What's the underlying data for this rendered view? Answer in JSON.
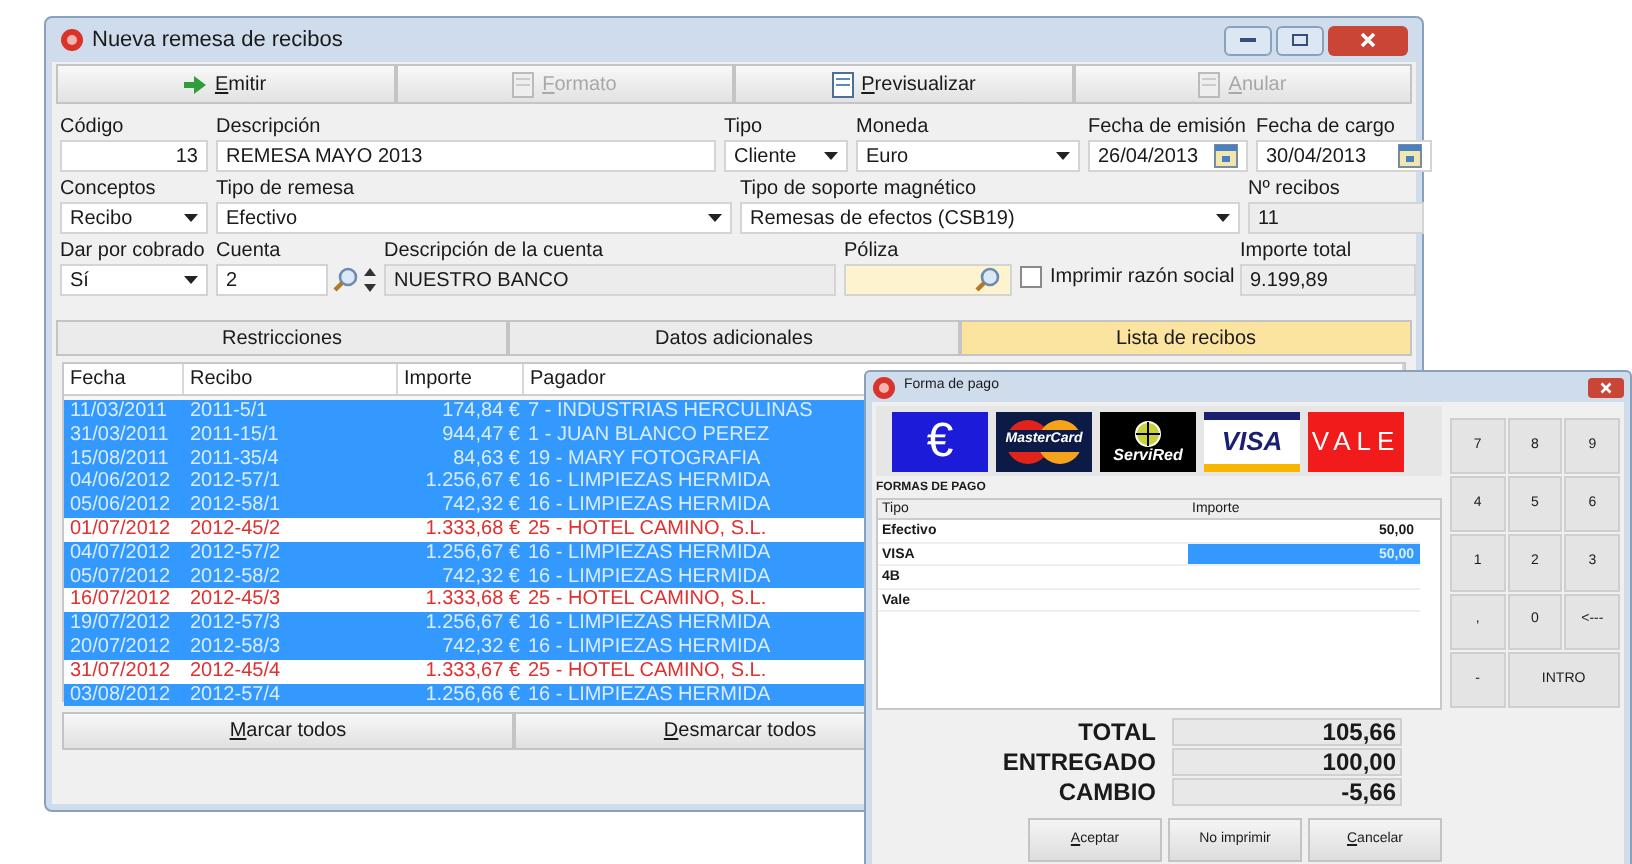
{
  "window": {
    "title": "Nueva remesa de recibos"
  },
  "toolbar": [
    {
      "label": "Emitir",
      "disabled": false,
      "kind": "arrow"
    },
    {
      "label": "Formato",
      "disabled": true,
      "kind": "doc"
    },
    {
      "label": "Previsualizar",
      "disabled": false,
      "kind": "doc"
    },
    {
      "label": "Anular",
      "disabled": true,
      "kind": "doc"
    }
  ],
  "form_rows": [
    [
      {
        "label": "Código",
        "value": "13",
        "kind": "number"
      },
      {
        "label": "Descripción",
        "value": "REMESA MAYO 2013",
        "kind": "text"
      },
      {
        "label": "Tipo",
        "value": "Cliente",
        "kind": "select"
      },
      {
        "label": "Moneda",
        "value": "Euro",
        "kind": "select"
      },
      {
        "label": "Fecha de emisión",
        "value": "26/04/2013",
        "kind": "date"
      },
      {
        "label": "Fecha de cargo",
        "value": "30/04/2013",
        "kind": "date"
      }
    ],
    [
      {
        "label": "Conceptos",
        "value": "Recibo",
        "kind": "select"
      },
      {
        "label": "Tipo de remesa",
        "value": "Efectivo",
        "kind": "select"
      },
      {
        "label": "Tipo de soporte magnético",
        "value": "Remesas de efectos (CSB19)",
        "kind": "select"
      },
      {
        "label": "Nº recibos",
        "value": "11",
        "kind": "readonly"
      }
    ],
    [
      {
        "label": "Dar por cobrado",
        "value": "Sí",
        "kind": "select"
      },
      {
        "label": "Cuenta",
        "value": "2",
        "kind": "spinlookup"
      },
      {
        "label": "Descripción de la cuenta",
        "value": "NUESTRO BANCO",
        "kind": "readonly"
      },
      {
        "label": "Póliza",
        "kind": "lookup"
      },
      {
        "label": "Imprimir razón social",
        "kind": "checkbox",
        "checked": false
      },
      {
        "label": "Importe total",
        "value": "9.199,89",
        "kind": "readonly"
      }
    ]
  ],
  "tabs": [
    {
      "label": "Restricciones",
      "selected": false
    },
    {
      "label": "Datos adicionales",
      "selected": false
    },
    {
      "label": "Lista de recibos",
      "selected": true
    }
  ],
  "table": {
    "columns": [
      "Fecha",
      "Recibo",
      "Importe",
      "Pagador"
    ],
    "rows": [
      {
        "cells": [
          "11/03/2011",
          "2011-5/1",
          "174,84 €",
          "7 - INDUSTRIAS HERCULINAS"
        ],
        "selected": true
      },
      {
        "cells": [
          "31/03/2011",
          "2011-15/1",
          "944,47 €",
          "1 - JUAN BLANCO PEREZ"
        ],
        "selected": true
      },
      {
        "cells": [
          "15/08/2011",
          "2011-35/4",
          "84,63 €",
          "19 - MARY FOTOGRAFIA"
        ],
        "selected": true
      },
      {
        "cells": [
          "04/06/2012",
          "2012-57/1",
          "1.256,67 €",
          "16 - LIMPIEZAS HERMIDA"
        ],
        "selected": true
      },
      {
        "cells": [
          "05/06/2012",
          "2012-58/1",
          "742,32 €",
          "16 - LIMPIEZAS HERMIDA"
        ],
        "selected": true
      },
      {
        "cells": [
          "01/07/2012",
          "2012-45/2",
          "1.333,68 €",
          "25 - HOTEL CAMINO, S.L."
        ],
        "selected": false
      },
      {
        "cells": [
          "04/07/2012",
          "2012-57/2",
          "1.256,67 €",
          "16 - LIMPIEZAS HERMIDA"
        ],
        "selected": true
      },
      {
        "cells": [
          "05/07/2012",
          "2012-58/2",
          "742,32 €",
          "16 - LIMPIEZAS HERMIDA"
        ],
        "selected": true
      },
      {
        "cells": [
          "16/07/2012",
          "2012-45/3",
          "1.333,68 €",
          "25 - HOTEL CAMINO, S.L."
        ],
        "selected": false
      },
      {
        "cells": [
          "19/07/2012",
          "2012-57/3",
          "1.256,67 €",
          "16 - LIMPIEZAS HERMIDA"
        ],
        "selected": true
      },
      {
        "cells": [
          "20/07/2012",
          "2012-58/3",
          "742,32 €",
          "16 - LIMPIEZAS HERMIDA"
        ],
        "selected": true
      },
      {
        "cells": [
          "31/07/2012",
          "2012-45/4",
          "1.333,67 €",
          "25 - HOTEL CAMINO, S.L."
        ],
        "selected": false
      },
      {
        "cells": [
          "03/08/2012",
          "2012-57/4",
          "1.256,66 €",
          "16 - LIMPIEZAS HERMIDA"
        ],
        "selected": true
      }
    ]
  },
  "buttons": [
    {
      "label": "Marcar todos",
      "mnemonic": true
    },
    {
      "label": "Desmarcar todos",
      "mnemonic": true
    }
  ],
  "dialog": {
    "title": "Forma de pago",
    "payment_methods": [
      {
        "kind": "euro",
        "label": "€"
      },
      {
        "kind": "mastercard",
        "label": "MasterCard"
      },
      {
        "kind": "servired",
        "label": "ServiRed"
      },
      {
        "kind": "visa",
        "label": "VISA"
      },
      {
        "kind": "vale",
        "label": "VALE"
      }
    ],
    "section_title": "FORMAS DE PAGO",
    "columns": [
      "Tipo",
      "Importe"
    ],
    "rows": [
      {
        "tipo": "Efectivo",
        "importe": "50,00",
        "selected": false
      },
      {
        "tipo": "VISA",
        "importe": "50,00",
        "selected": true
      },
      {
        "tipo": "4B",
        "selected": false
      },
      {
        "tipo": "Vale",
        "selected": false
      }
    ],
    "keypad": [
      {
        "label": "7",
        "kind": "key"
      },
      {
        "label": "8",
        "kind": "key"
      },
      {
        "label": "9",
        "kind": "key"
      },
      {
        "label": "4",
        "kind": "key"
      },
      {
        "label": "5",
        "kind": "key"
      },
      {
        "label": "6",
        "kind": "key"
      },
      {
        "label": "1",
        "kind": "key"
      },
      {
        "label": "2",
        "kind": "key"
      },
      {
        "label": "3",
        "kind": "key"
      },
      {
        "label": ",",
        "kind": "key"
      },
      {
        "label": "0",
        "kind": "key"
      },
      {
        "label": "<---",
        "kind": "key"
      },
      {
        "label": "-",
        "kind": "key"
      },
      {
        "label": "INTRO",
        "kind": "wide"
      }
    ],
    "totals": [
      {
        "label": "TOTAL",
        "value": "105,66"
      },
      {
        "label": "ENTREGADO",
        "value": "100,00"
      },
      {
        "label": "CAMBIO",
        "value": "-5,66"
      }
    ],
    "buttons": [
      {
        "label": "Aceptar",
        "mnemonic": true
      },
      {
        "label": "No imprimir",
        "mnemonic": false
      },
      {
        "label": "Cancelar",
        "mnemonic": true
      }
    ]
  }
}
